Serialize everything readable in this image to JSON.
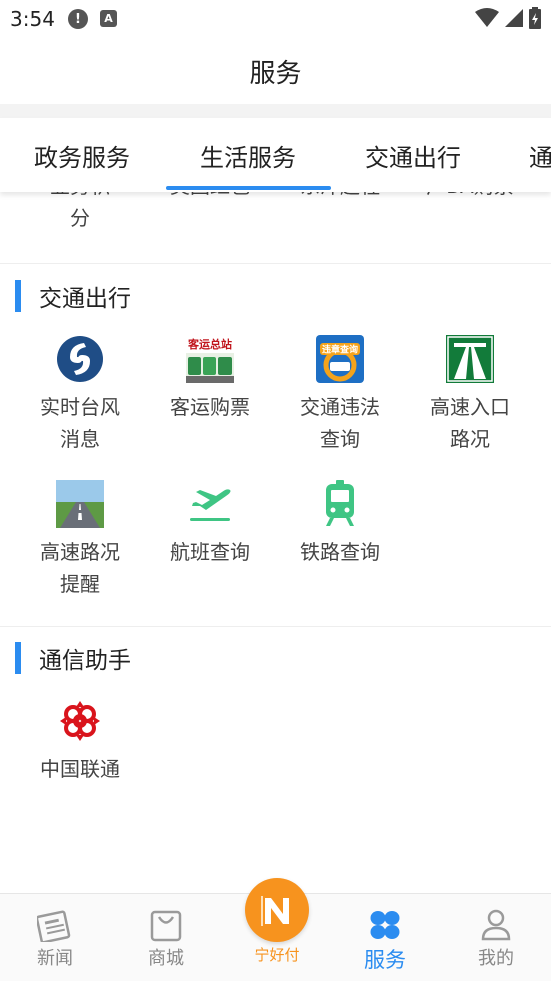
{
  "status_bar": {
    "time": "3:54",
    "left_icons": [
      "alert-icon",
      "a-icon"
    ],
    "right_icons": [
      "wifi-icon",
      "signal-icon",
      "battery-icon"
    ]
  },
  "header": {
    "title": "服务"
  },
  "tabs": [
    {
      "label": "政务服务",
      "active": false
    },
    {
      "label": "生活服务",
      "active": true
    },
    {
      "label": "交通出行",
      "active": false
    },
    {
      "label": "通",
      "active": false
    }
  ],
  "partial_row": [
    {
      "line1": "业务积",
      "line2": "分"
    },
    {
      "line1": "美团红包",
      "line2": ""
    },
    {
      "line1": "东洋超程",
      "line2": ""
    },
    {
      "line1": "广BA购票",
      "line2": ""
    }
  ],
  "sections": [
    {
      "title": "交通出行",
      "items": [
        {
          "label_line1": "实时台风",
          "label_line2": "消息",
          "icon": "typhoon-icon"
        },
        {
          "label_line1": "客运购票",
          "label_line2": "",
          "icon": "bus-station-icon",
          "icon_text": "客运总站"
        },
        {
          "label_line1": "交通违法",
          "label_line2": "查询",
          "icon": "traffic-violation-icon",
          "icon_text": "违章查询"
        },
        {
          "label_line1": "高速入口",
          "label_line2": "路况",
          "icon": "highway-icon"
        },
        {
          "label_line1": "高速路况",
          "label_line2": "提醒",
          "icon": "highway-road-icon"
        },
        {
          "label_line1": "航班查询",
          "label_line2": "",
          "icon": "airplane-icon"
        },
        {
          "label_line1": "铁路查询",
          "label_line2": "",
          "icon": "train-icon"
        }
      ]
    },
    {
      "title": "通信助手",
      "items": [
        {
          "label_line1": "中国联通",
          "label_line2": "",
          "icon": "china-unicom-icon"
        }
      ]
    }
  ],
  "bottom_nav": [
    {
      "label": "新闻",
      "icon": "news-icon",
      "active": false
    },
    {
      "label": "商城",
      "icon": "shopping-bag-icon",
      "active": false
    },
    {
      "label": "宁好付",
      "icon": "pay-logo-icon",
      "active": false
    },
    {
      "label": "服务",
      "icon": "services-icon",
      "active": true
    },
    {
      "label": "我的",
      "icon": "profile-icon",
      "active": false
    }
  ],
  "colors": {
    "accent": "#2b8cf0",
    "pay_orange": "#f7931e",
    "unicom_red": "#d9141c",
    "flight_green": "#3fc584"
  }
}
